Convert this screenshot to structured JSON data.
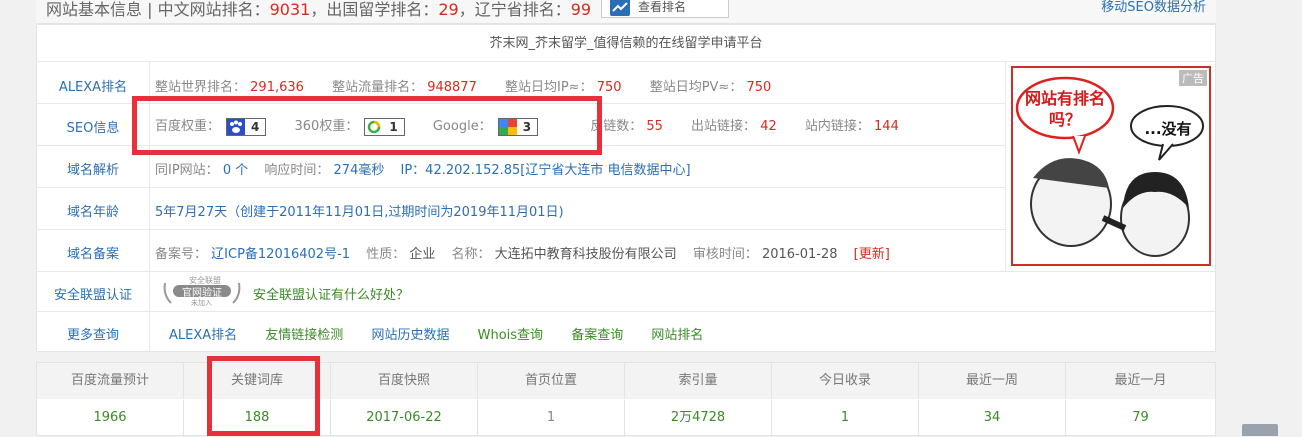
{
  "header": {
    "title": "网站基本信息",
    "sep": "|",
    "cn_rank_label": "中文网站排名：",
    "cn_rank_value": "9031",
    "abroad_label": "，出国留学排名：",
    "abroad_value": "29",
    "province_label": "，辽宁省排名：",
    "province_value": "99",
    "view_rank_button": "查看排名",
    "mobile_seo_link": "移动SEO数据分析"
  },
  "site_title": "芥末网_芥末留学_值得信赖的在线留学申请平台",
  "rows": {
    "alexa": {
      "label": "ALEXA排名",
      "world_rank_label": "整站世界排名：",
      "world_rank_value": "291,636",
      "traffic_rank_label": "整站流量排名：",
      "traffic_rank_value": "948877",
      "daily_ip_label": "整站日均IP≈：",
      "daily_ip_value": "750",
      "daily_pv_label": "整站日均PV≈：",
      "daily_pv_value": "750"
    },
    "seo": {
      "label": "SEO信息",
      "baidu_label": "百度权重：",
      "baidu_value": "4",
      "q360_label": "360权重：",
      "q360_value": "1",
      "google_label": "Google：",
      "google_value": "3",
      "backlinks_label": "反链数：",
      "backlinks_value": "55",
      "outlinks_label": "出站链接：",
      "outlinks_value": "42",
      "inlinks_label": "站内链接：",
      "inlinks_value": "144"
    },
    "dns": {
      "label": "域名解析",
      "same_ip_label": "同IP网站：",
      "same_ip_value": "0 个",
      "resp_label": "响应时间：",
      "resp_value": "274毫秒",
      "ip_text": "IP：42.202.152.85[辽宁省大连市 电信数据中心]"
    },
    "age": {
      "label": "域名年龄",
      "text": "5年7月27天（创建于2011年11月01日,过期时间为2019年11月01日)"
    },
    "icp": {
      "label": "域名备案",
      "icp_label": "备案号：",
      "icp_value": "辽ICP备12016402号-1",
      "nature_label": "性质：",
      "nature_value": "企业",
      "name_label": "名称：",
      "name_value": "大连拓中教育科技股份有限公司",
      "audit_label": "审核时间：",
      "audit_value": "2016-01-28",
      "update_link": "[更新]"
    },
    "security": {
      "label": "安全联盟认证",
      "seal_top": "安全联盟",
      "seal_main": "官网验证",
      "seal_sub": "未加入",
      "link": "安全联盟认证有什么好处？"
    },
    "more": {
      "label": "更多查询",
      "links": [
        "ALEXA排名",
        "友情链接检测",
        "网站历史数据",
        "Whois查询",
        "备案查询",
        "网站排名"
      ]
    }
  },
  "ad": {
    "tag": "广告",
    "bubble1": "网站有排名吗？",
    "bubble2": "...没有"
  },
  "stats": {
    "headers": [
      "百度流量预计",
      "关键词库",
      "百度快照",
      "首页位置",
      "索引量",
      "今日收录",
      "最近一周",
      "最近一月"
    ],
    "values": [
      "1966",
      "188",
      "2017-06-22",
      "1",
      "2万4728",
      "1",
      "34",
      "79"
    ]
  },
  "colors": {
    "accent_red": "#d52b1e",
    "link_blue": "#2a6fb5",
    "link_green": "#3a8b26",
    "highlight_box": "#e8303a"
  }
}
